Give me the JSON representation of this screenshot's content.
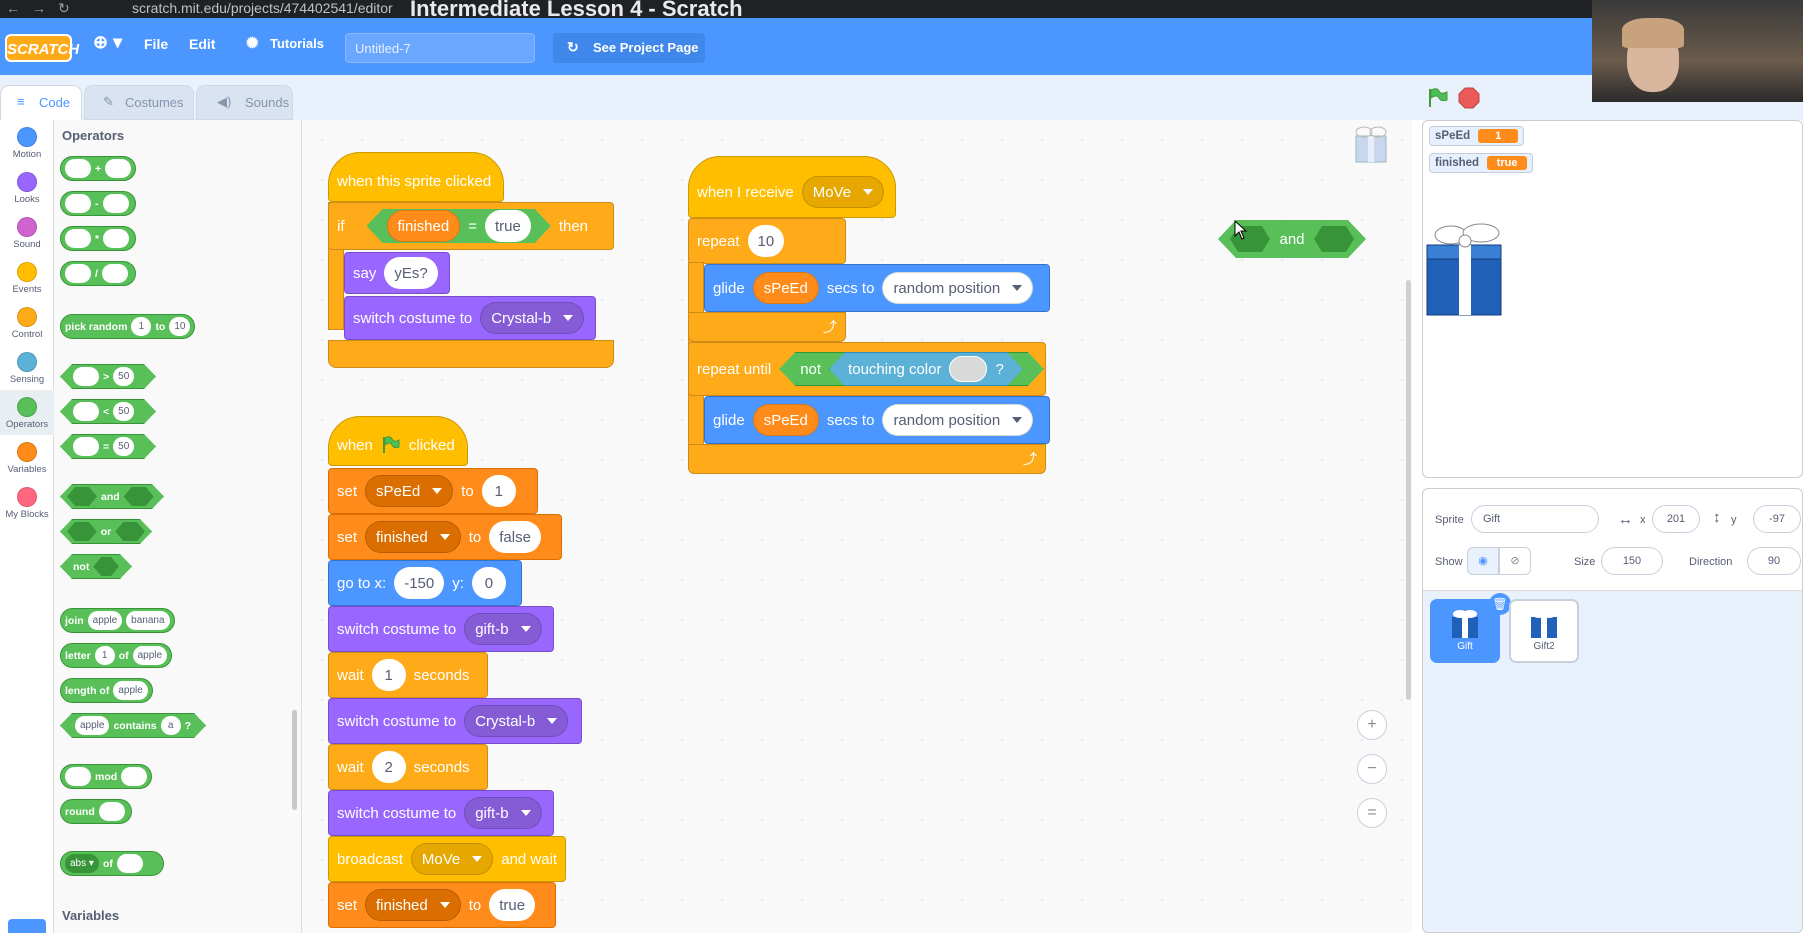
{
  "browser": {
    "url": "scratch.mit.edu/projects/474402541/editor",
    "title": "Intermediate Lesson 4 - Scratch"
  },
  "menu": {
    "logo": "SCRATCH",
    "file": "File",
    "edit": "Edit",
    "tutorials": "Tutorials",
    "project_title": "Untitled-7",
    "see_project": "See Project Page"
  },
  "tabs": [
    {
      "label": "Code"
    },
    {
      "label": "Costumes"
    },
    {
      "label": "Sounds"
    }
  ],
  "categories": [
    {
      "label": "Motion",
      "color": "#4c97ff"
    },
    {
      "label": "Looks",
      "color": "#9966ff"
    },
    {
      "label": "Sound",
      "color": "#cf63cf"
    },
    {
      "label": "Events",
      "color": "#ffbf00"
    },
    {
      "label": "Control",
      "color": "#ffab19"
    },
    {
      "label": "Sensing",
      "color": "#5cb1d6"
    },
    {
      "label": "Operators",
      "color": "#59c059"
    },
    {
      "label": "Variables",
      "color": "#ff8c1a"
    },
    {
      "label": "My Blocks",
      "color": "#ff6680"
    }
  ],
  "palette": {
    "heading": "Operators",
    "footer_heading": "Variables",
    "add": "+",
    "sub": "-",
    "mul": "*",
    "div": "/",
    "pick_random": "pick random",
    "to": "to",
    "rand_from": "1",
    "rand_to": "10",
    "gt": ">",
    "lt": "<",
    "eq": "=",
    "cmp_val": "50",
    "and": "and",
    "or": "or",
    "not": "not",
    "join": "join",
    "join_a": "apple",
    "join_b": "banana",
    "letter": "letter",
    "letter_n": "1",
    "of": "of",
    "letter_s": "apple",
    "length_of": "length of",
    "length_s": "apple",
    "contains_a": "apple",
    "contains": "contains",
    "contains_b": "a",
    "q": "?",
    "mod": "mod",
    "round": "round",
    "abs": "abs"
  },
  "scripts": {
    "s1": {
      "hat": "when this sprite clicked",
      "if": "if",
      "var": "finished",
      "eq": "=",
      "val": "true",
      "then": "then",
      "say": "say",
      "say_val": "yEs?",
      "switch": "switch costume to",
      "costume": "Crystal-b"
    },
    "s2": {
      "hat_when": "when",
      "hat_clicked": "clicked",
      "set": "set",
      "var1": "sPeEd",
      "to": "to",
      "val1": "1",
      "var2": "finished",
      "val2": "false",
      "goto": "go to x:",
      "x": "-150",
      "y_lbl": "y:",
      "y": "0",
      "switch": "switch costume to",
      "c1": "gift-b",
      "wait": "wait",
      "w1": "1",
      "seconds": "seconds",
      "c2": "Crystal-b",
      "w2": "2",
      "c3": "gift-b",
      "broadcast": "broadcast",
      "msg": "MoVe",
      "and_wait": "and wait",
      "var3": "finished",
      "val3": "true"
    },
    "s3": {
      "hat": "when I receive",
      "msg": "MoVe",
      "repeat": "repeat",
      "times": "10",
      "glide": "glide",
      "speed": "sPeEd",
      "secs_to": "secs to",
      "target": "random position",
      "repeat_until": "repeat until",
      "not": "not",
      "touching": "touching color",
      "q": "?"
    },
    "loose": {
      "and": "and"
    }
  },
  "stage": {
    "monitors": [
      {
        "name": "sPeEd",
        "value": "1"
      },
      {
        "name": "finished",
        "value": "true"
      }
    ]
  },
  "sprite_info": {
    "sprite_label": "Sprite",
    "name": "Gift",
    "x_label": "x",
    "x": "201",
    "y_label": "y",
    "y": "-97",
    "show_label": "Show",
    "size_label": "Size",
    "size": "150",
    "direction_label": "Direction",
    "direction": "90"
  },
  "sprites": [
    {
      "name": "Gift"
    },
    {
      "name": "Gift2"
    }
  ],
  "zoom": {
    "in": "+",
    "out": "−",
    "reset": "="
  }
}
